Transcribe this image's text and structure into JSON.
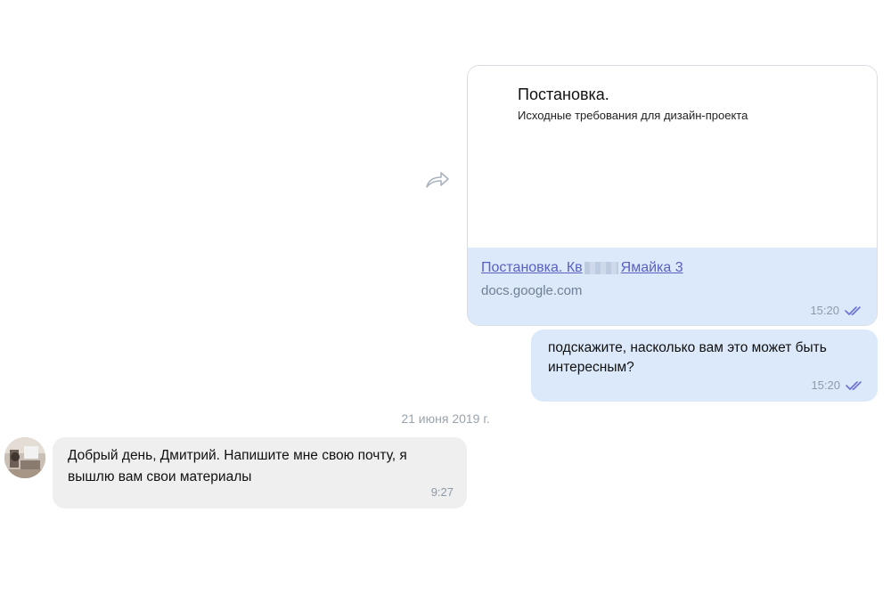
{
  "link_message": {
    "doc_title": "Постановка.",
    "doc_subtitle": "Исходные требования для дизайн-проекта",
    "link_title_start": "Постановка. Кв",
    "link_title_end": "Ямайка 3",
    "link_domain": "docs.google.com",
    "time": "15:20"
  },
  "outgoing_message": {
    "text": "подскажите, насколько вам это может быть интересным?",
    "time": "15:20"
  },
  "date_separator": "21 июня 2019 г.",
  "incoming_message": {
    "text": "Добрый день, Дмитрий. Напишите мне свою почту, я вышлю вам свои материалы",
    "time": "9:27"
  },
  "colors": {
    "outgoing_bubble": "#dbe9fb",
    "incoming_bubble": "#efefef",
    "link": "#5a5fc2",
    "read_checks": "#6b72d4"
  },
  "icons": [
    "forward-icon",
    "double-check-icon",
    "avatar"
  ]
}
